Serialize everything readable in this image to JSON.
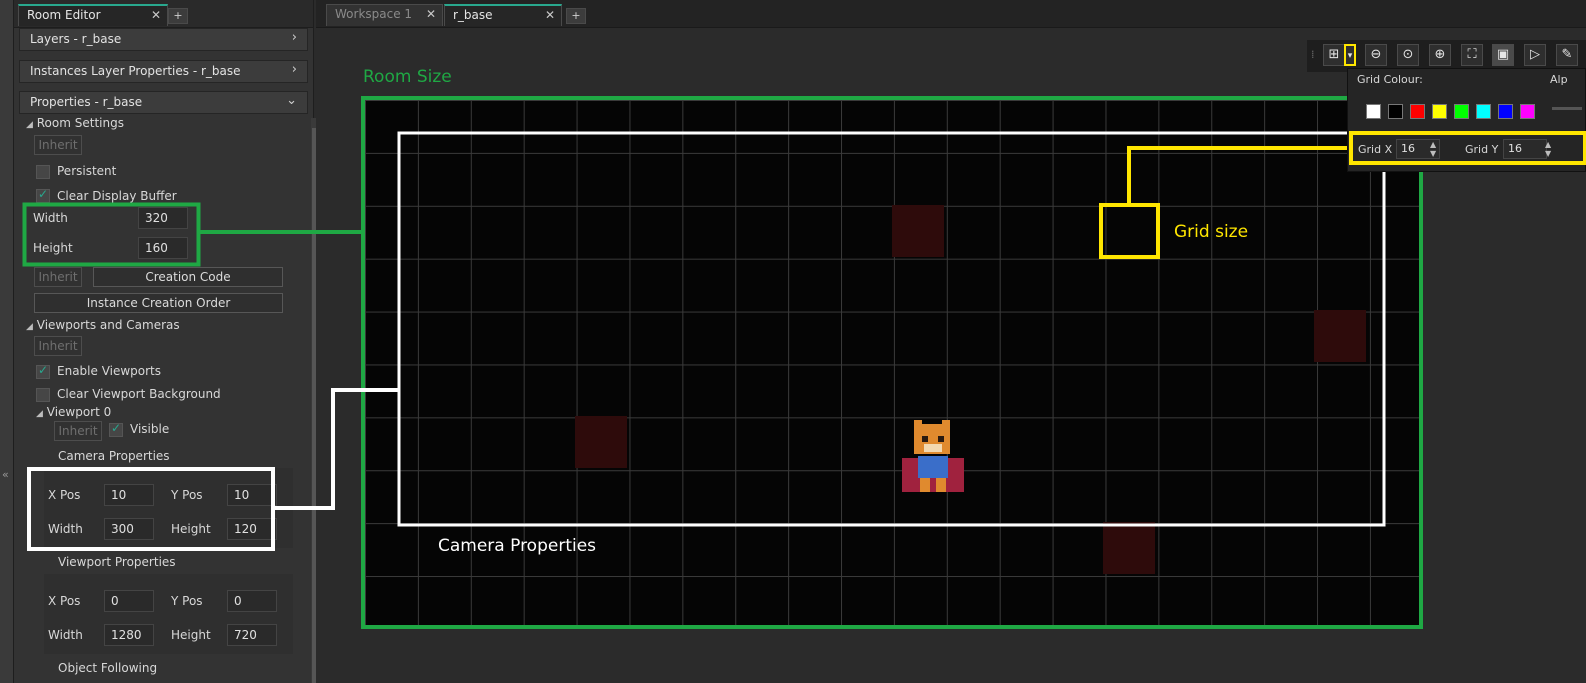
{
  "left_panel": {
    "tab_label": "Room Editor",
    "layers_header": "Layers - r_base",
    "instances_header": "Instances Layer Properties - r_base",
    "properties_header": "Properties - r_base",
    "room_settings": "Room Settings",
    "inherit": "Inherit",
    "persistent": "Persistent",
    "clear_display_buffer": "Clear Display Buffer",
    "width_label": "Width",
    "width_value": "320",
    "height_label": "Height",
    "height_value": "160",
    "creation_code": "Creation Code",
    "instance_creation_order": "Instance Creation Order",
    "viewports_cameras": "Viewports and Cameras",
    "enable_viewports": "Enable Viewports",
    "clear_viewport_bg": "Clear Viewport Background",
    "viewport0": "Viewport 0",
    "visible": "Visible",
    "camera_properties": "Camera Properties",
    "cam": {
      "xpos_label": "X Pos",
      "xpos": "10",
      "ypos_label": "Y Pos",
      "ypos": "10",
      "width_label": "Width",
      "width": "300",
      "height_label": "Height",
      "height": "120"
    },
    "viewport_properties": "Viewport Properties",
    "vp": {
      "xpos_label": "X Pos",
      "xpos": "0",
      "ypos_label": "Y Pos",
      "ypos": "0",
      "width_label": "Width",
      "width": "1280",
      "height_label": "Height",
      "height": "720"
    },
    "object_following": "Object Following"
  },
  "workspace": {
    "tabs": [
      "Workspace 1",
      "r_base"
    ],
    "room_size_label": "Room Size",
    "camera_properties_label": "Camera Properties",
    "grid_size_label": "Grid size",
    "grid_colour": "Grid Colour:",
    "alpha_label": "Alp",
    "grid_x_label": "Grid X",
    "grid_x": "16",
    "grid_y_label": "Grid Y",
    "grid_y": "16",
    "swatch_colors": [
      "#ffffff",
      "#000000",
      "#ff0000",
      "#ffff00",
      "#00ff00",
      "#00ffff",
      "#0000ff",
      "#ff00ff"
    ]
  },
  "colors": {
    "green_annotation": "#1fa844",
    "yellow_annotation": "#ffe600",
    "white_annotation": "#ffffff",
    "tab_accent": "#29a88e"
  }
}
